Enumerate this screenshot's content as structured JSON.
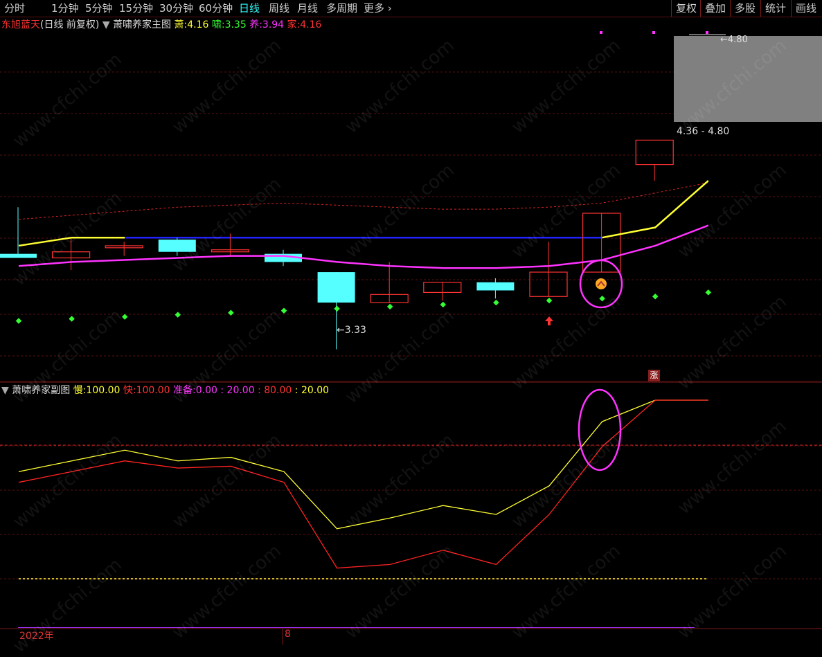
{
  "toolbar": {
    "periods": [
      "分时",
      "1分钟",
      "5分钟",
      "15分钟",
      "30分钟",
      "60分钟",
      "日线",
      "周线",
      "月线",
      "多周期",
      "更多"
    ],
    "more_chevron": "›",
    "right_buttons": [
      "复权",
      "叠加",
      "多股",
      "统计",
      "画线"
    ]
  },
  "main_info": {
    "stock_name": "东旭蓝天",
    "period_desc": "(日线 前复权)",
    "indicator_name": "萧啸养家主图",
    "xiao_label": "萧:",
    "xiao_value": "4.16",
    "xiao2_label": "啸:",
    "xiao2_value": "3.35",
    "yang_label": "养:",
    "yang_value": "3.94",
    "jia_label": "家:",
    "jia_value": "4.16"
  },
  "sub_info": {
    "indicator_name": "萧啸养家副图",
    "slow_label": "慢:",
    "slow_value": "100.00",
    "fast_label": "快:",
    "fast_value": "100.00",
    "ready_label": "准备:",
    "ready_value": "0.00",
    "v1": ": 20.00",
    "v2": ": 80.00",
    "v3": ": 20.00"
  },
  "annotations": {
    "high_label": "4.80",
    "low_label": "3.33",
    "range_label": "4.36 - 4.80",
    "badge": "涨"
  },
  "time_axis": {
    "year_label": "2022年",
    "month_label": "8"
  },
  "watermark": "www.cfchi.com",
  "colors": {
    "up": "#ff3333",
    "down": "#55ffff",
    "yellow": "#ffff33",
    "magenta": "#ff33ff",
    "blue": "#2222ff",
    "green": "#33ff33"
  },
  "chart_data": {
    "type": "candlestick",
    "candles": [
      {
        "o": 3.8,
        "h": 4.03,
        "l": 3.78,
        "c": 3.78,
        "dir": "down"
      },
      {
        "o": 3.78,
        "h": 3.88,
        "l": 3.72,
        "c": 3.81,
        "dir": "up"
      },
      {
        "o": 3.83,
        "h": 3.86,
        "l": 3.79,
        "c": 3.84,
        "dir": "up"
      },
      {
        "o": 3.87,
        "h": 3.88,
        "l": 3.79,
        "c": 3.81,
        "dir": "down"
      },
      {
        "o": 3.81,
        "h": 3.9,
        "l": 3.79,
        "c": 3.82,
        "dir": "up"
      },
      {
        "o": 3.8,
        "h": 3.82,
        "l": 3.74,
        "c": 3.76,
        "dir": "down"
      },
      {
        "o": 3.71,
        "h": 3.71,
        "l": 3.33,
        "c": 3.56,
        "dir": "down"
      },
      {
        "o": 3.56,
        "h": 3.76,
        "l": 3.56,
        "c": 3.6,
        "dir": "up"
      },
      {
        "o": 3.61,
        "h": 3.66,
        "l": 3.57,
        "c": 3.66,
        "dir": "up"
      },
      {
        "o": 3.66,
        "h": 3.68,
        "l": 3.58,
        "c": 3.62,
        "dir": "down"
      },
      {
        "o": 3.59,
        "h": 3.86,
        "l": 3.59,
        "c": 3.71,
        "dir": "up"
      },
      {
        "o": 3.71,
        "h": 4.0,
        "l": 3.71,
        "c": 4.0,
        "dir": "up"
      },
      {
        "o": 4.24,
        "h": 4.24,
        "l": 4.16,
        "c": 4.36,
        "dir": "up"
      }
    ],
    "ma_yellow": [
      3.84,
      3.88,
      3.88,
      null,
      null,
      null,
      null,
      null,
      null,
      null,
      null,
      3.88,
      3.93,
      4.16
    ],
    "ma_magenta": [
      3.74,
      3.76,
      3.77,
      3.78,
      3.79,
      3.79,
      3.76,
      3.74,
      3.73,
      3.73,
      3.74,
      3.77,
      3.84,
      3.94
    ],
    "upper_dashed": [
      3.97,
      3.99,
      4.01,
      4.03,
      4.04,
      4.05,
      4.04,
      4.03,
      4.02,
      4.02,
      4.03,
      4.05,
      4.1,
      4.15
    ],
    "blue_line": 3.88,
    "green_dots": [
      3.47,
      3.48,
      3.49,
      3.5,
      3.51,
      3.52,
      3.53,
      3.54,
      3.55,
      3.56,
      3.57,
      3.58,
      3.59,
      3.61
    ],
    "sub_slow": [
      60,
      66,
      72,
      66,
      68,
      60,
      28,
      34,
      41,
      36,
      52,
      88,
      100,
      100
    ],
    "sub_fast": [
      54,
      60,
      66,
      62,
      63,
      54,
      6,
      8,
      16,
      8,
      36,
      74,
      100,
      100
    ],
    "sub_ylim": [
      0,
      100
    ],
    "main_ylim": [
      3.25,
      4.9
    ]
  }
}
